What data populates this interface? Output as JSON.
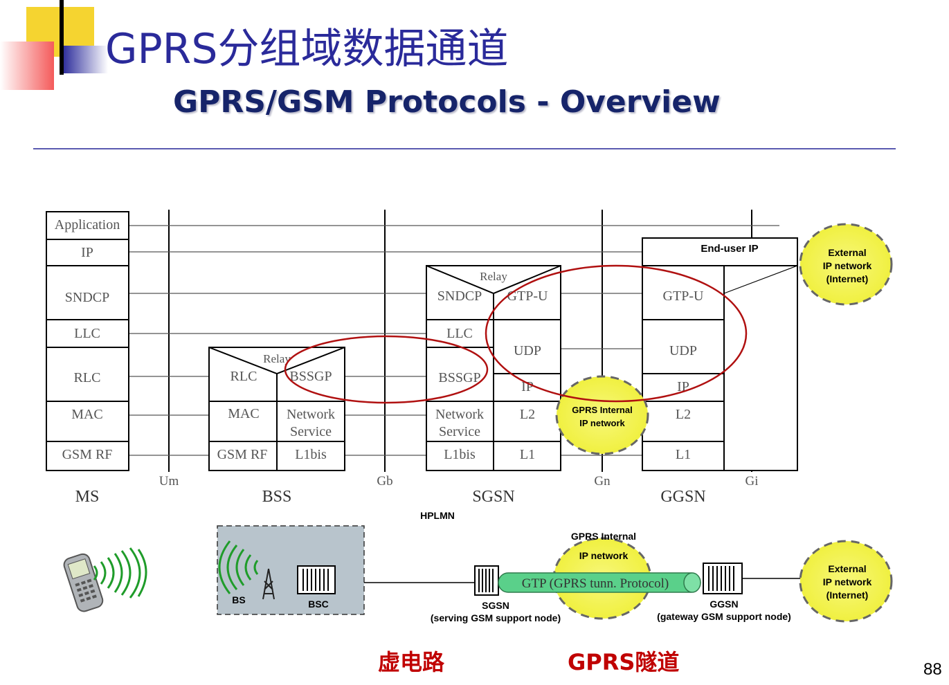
{
  "slide": {
    "title": "GPRS分组域数据通道",
    "subtitle": "GPRS/GSM Protocols - Overview",
    "page_number": "88",
    "annotations": {
      "virtual_circuit": "虚电路",
      "gprs_tunnel": "GPRS隧道"
    }
  },
  "stack": {
    "ms": {
      "name": "MS",
      "layers": [
        "Application",
        "IP",
        "SNDCP",
        "LLC",
        "RLC",
        "MAC",
        "GSM RF"
      ]
    },
    "bss": {
      "name": "BSS",
      "relay": "Relay",
      "left": [
        "RLC",
        "MAC",
        "GSM RF"
      ],
      "right": [
        "BSSGP",
        "Network",
        "Service",
        "L1bis"
      ]
    },
    "sgsn": {
      "name": "SGSN",
      "relay": "Relay",
      "left": [
        "SNDCP",
        "LLC",
        "BSSGP",
        "Network",
        "Service",
        "L1bis"
      ],
      "right": [
        "GTP-U",
        "UDP",
        "IP",
        "L2",
        "L1"
      ]
    },
    "ggsn": {
      "name": "GGSN",
      "top": "End-user IP",
      "layers": [
        "GTP-U",
        "UDP",
        "IP",
        "L2",
        "L1"
      ]
    },
    "interfaces": [
      "Um",
      "Gb",
      "Gn",
      "Gi"
    ],
    "hplmn": "HPLMN",
    "gprs_internal_top": [
      "GPRS Internal",
      "IP network"
    ],
    "external_top": [
      "External",
      "IP network",
      "(Internet)"
    ]
  },
  "network": {
    "bs": "BS",
    "bsc": "BSC",
    "sgsn": "SGSN",
    "sgsn_desc": "(serving GSM support node)",
    "ggsn": "GGSN",
    "ggsn_desc": "(gateway GSM support node)",
    "gtp_tunnel": "GTP (GPRS tunn. Protocol)",
    "gprs_internal": [
      "GPRS Internal",
      "IP network"
    ],
    "external": [
      "External",
      "IP network",
      "(Internet)"
    ]
  },
  "colors": {
    "title": "#2a2a9a",
    "subtitle": "#16246a",
    "highlight_ellipse": "#b01010",
    "cloud": "#f2f25a",
    "tunnel": "#5ad08a",
    "annotation": "#c00000"
  }
}
